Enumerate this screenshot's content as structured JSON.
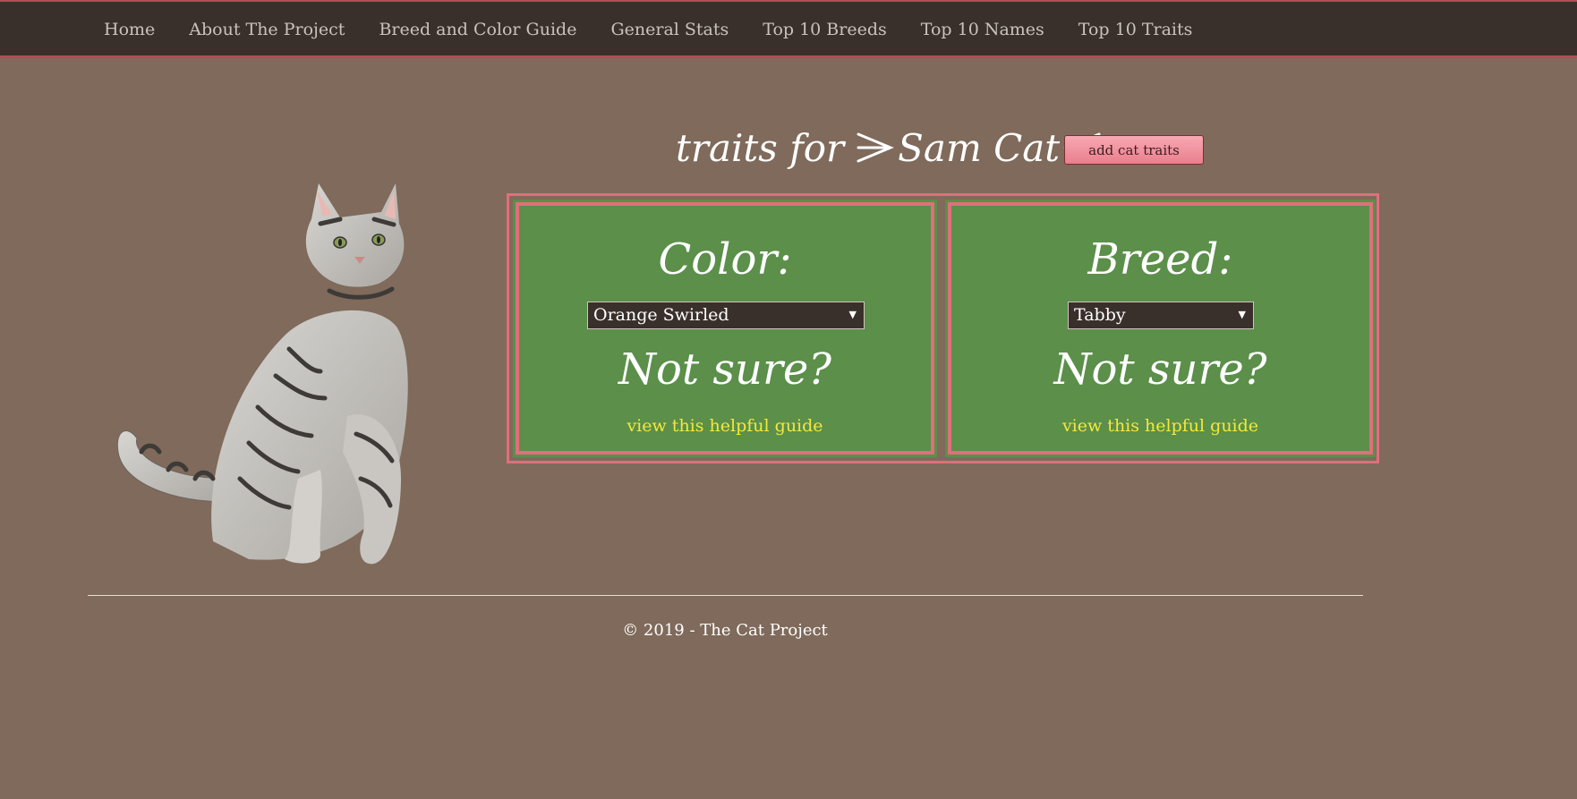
{
  "nav": {
    "items": [
      {
        "label": "Home"
      },
      {
        "label": "About The Project"
      },
      {
        "label": "Breed and Color Guide"
      },
      {
        "label": "General Stats"
      },
      {
        "label": "Top 10 Breeds"
      },
      {
        "label": "Top 10 Names"
      },
      {
        "label": "Top 10 Traits"
      }
    ]
  },
  "heading": {
    "prefix": "traits for",
    "cat_name": "Sam Cat"
  },
  "add_button": {
    "label": "add cat traits"
  },
  "color_panel": {
    "label": "Color:",
    "selected": "Orange Swirled",
    "not_sure": "Not sure?",
    "link": "view this helpful guide"
  },
  "breed_panel": {
    "label": "Breed:",
    "selected": "Tabby",
    "not_sure": "Not sure?",
    "link": "view this helpful guide"
  },
  "footer": {
    "text": "© 2019 - The Cat Project"
  },
  "colors": {
    "background": "#7f6a5b",
    "nav": "#3a302b",
    "accent": "#e06f7b",
    "panel": "#5b8f4a",
    "link": "#f5e83a"
  }
}
